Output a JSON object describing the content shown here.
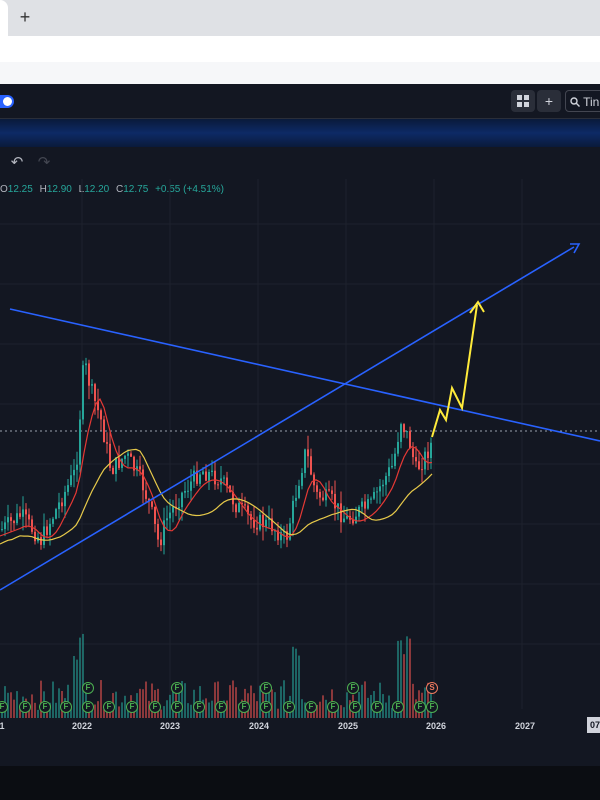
{
  "browser": {
    "new_tab_label": "+"
  },
  "toolbar": {
    "layout_icon": "grid-icon",
    "add_label": "+",
    "search_label": "Tin"
  },
  "ohlc": {
    "open_label": "O",
    "open": "12.25",
    "high_label": "H",
    "high": "12.90",
    "low_label": "L",
    "low": "12.20",
    "close_label": "C",
    "close": "12.75",
    "change": "+0.55 (+4.51%)"
  },
  "x_axis": {
    "labels": [
      "1",
      "2022",
      "2023",
      "2024",
      "2025",
      "2026",
      "2027"
    ],
    "current_label": "07"
  },
  "events": {
    "row_top": [
      "F",
      "F",
      "F",
      "F",
      "S"
    ],
    "row_bottom": [
      "F",
      "F",
      "F",
      "F",
      "F",
      "F",
      "F",
      "F",
      "F",
      "F",
      "F",
      "F",
      "F",
      "F",
      "F",
      "F",
      "F",
      "F",
      "F",
      "F",
      "F",
      "S"
    ]
  },
  "colors": {
    "background": "#131722",
    "up": "#26a69a",
    "down": "#ef5350",
    "trendline": "#2962ff",
    "projection": "#ffeb3b",
    "ma_fast": "#e53935",
    "ma_slow": "#e6c94a"
  },
  "chart_data": {
    "type": "candlestick",
    "x_axis_years": [
      "2022",
      "2023",
      "2024",
      "2025",
      "2026",
      "2027"
    ],
    "last_bar": {
      "open": 12.25,
      "high": 12.9,
      "low": 12.2,
      "close": 12.75,
      "change": 0.55,
      "change_pct": 4.51
    },
    "overlays": [
      "descending trendline",
      "ascending trendline",
      "projected path arrow",
      "moving average (red)",
      "moving average (yellow)"
    ]
  }
}
